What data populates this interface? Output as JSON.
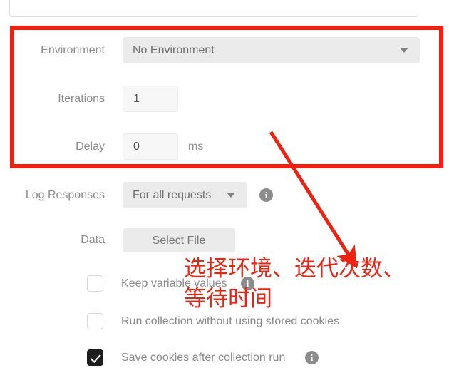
{
  "colors": {
    "annotation_red": "#ee2211",
    "field_gray": "#ebebeb",
    "label_gray": "#8c8c8c",
    "checkbox_checked": "#1d1d1d"
  },
  "top_field": {
    "name": "collection-name-input",
    "value": ""
  },
  "form": {
    "environment": {
      "label": "Environment",
      "value": "No Environment",
      "caret_icon": "chevron-down-icon"
    },
    "iterations": {
      "label": "Iterations",
      "value": "1"
    },
    "delay": {
      "label": "Delay",
      "value": "0",
      "unit": "ms"
    },
    "log_responses": {
      "label": "Log Responses",
      "value": "For all requests",
      "caret_icon": "chevron-down-icon",
      "info_icon": "info-icon",
      "info_glyph": "i"
    },
    "data": {
      "label": "Data",
      "button_label": "Select File"
    }
  },
  "checkboxes": [
    {
      "label": "Keep variable values",
      "checked": false,
      "has_info": true,
      "info_glyph": "i"
    },
    {
      "label": "Run collection without using stored cookies",
      "checked": false,
      "has_info": false,
      "info_glyph": "i"
    },
    {
      "label": "Save cookies after collection run",
      "checked": true,
      "has_info": true,
      "info_glyph": "i"
    }
  ],
  "annotation": {
    "line1": "选择环境、迭代次数、",
    "line2": "等待时间",
    "arrow": "red-arrow",
    "highlight_box": "red-highlight-box"
  }
}
